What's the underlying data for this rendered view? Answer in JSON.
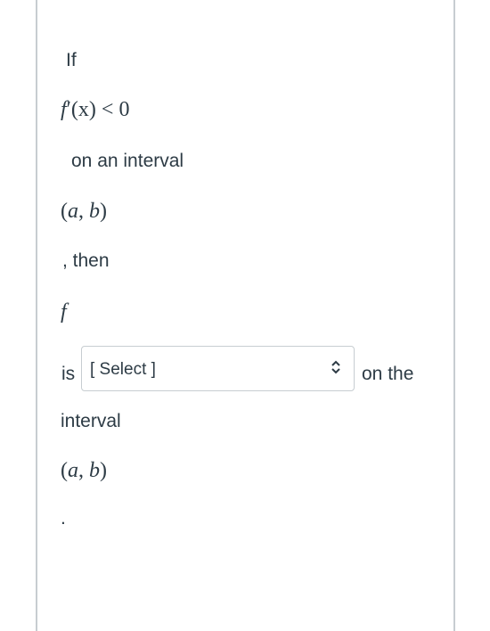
{
  "question": {
    "text_if": "If",
    "math_condition": {
      "func": "f",
      "prime": "′",
      "rest": "(x) < 0"
    },
    "text_interval1": "on an interval",
    "math_interval1": {
      "open": "(",
      "a": "a",
      "sep": ", ",
      "b": "b",
      "close": ")"
    },
    "text_then": ", then",
    "math_f": "f",
    "text_is": "is",
    "select": {
      "value": "[ Select ]",
      "icon": "up-down-chevron-icon"
    },
    "text_on_the": "on the",
    "text_interval2": "interval",
    "math_interval2": {
      "open": "(",
      "a": "a",
      "sep": ", ",
      "b": "b",
      "close": ")"
    },
    "text_period": "."
  }
}
